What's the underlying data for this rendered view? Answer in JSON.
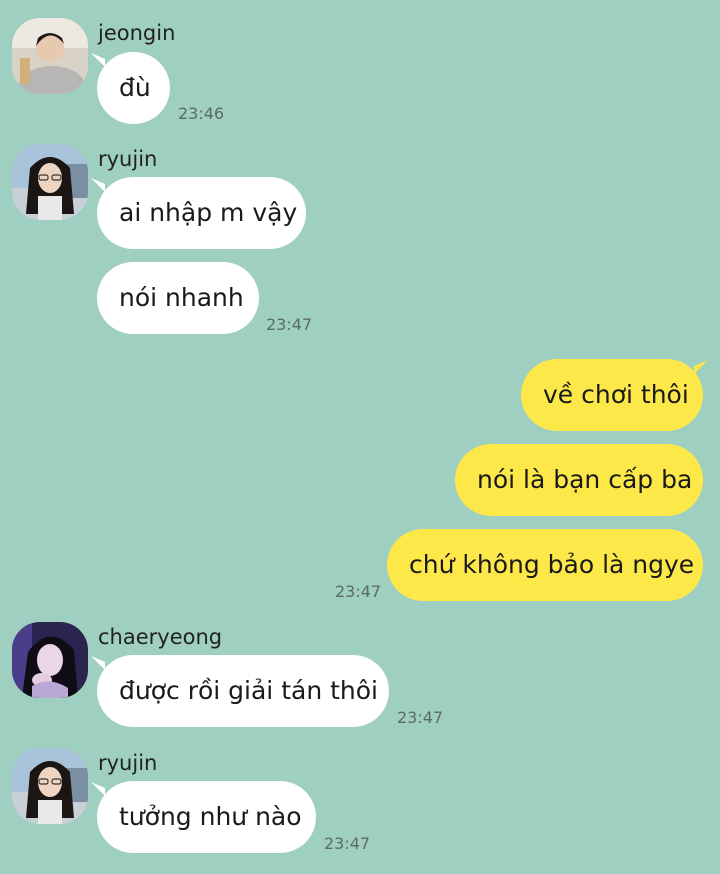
{
  "messages": [
    {
      "sender": "jeongin",
      "text": "đù",
      "time": "23:46"
    },
    {
      "sender": "ryujin",
      "text": "ai nhập m vậy"
    },
    {
      "text": "nói nhanh",
      "time": "23:47"
    },
    {
      "text": "về chơi thôi"
    },
    {
      "text": "nói là bạn cấp ba"
    },
    {
      "text": "chứ không bảo là ngye",
      "time": "23:47"
    },
    {
      "sender": "chaeryeong",
      "text": "được rồi giải tán thôi",
      "time": "23:47"
    },
    {
      "sender": "ryujin",
      "text": "tưởng như nào",
      "time": "23:47"
    }
  ],
  "colors": {
    "background": "#9fcfc0",
    "incoming_bubble": "#ffffff",
    "outgoing_bubble": "#fde84a"
  }
}
